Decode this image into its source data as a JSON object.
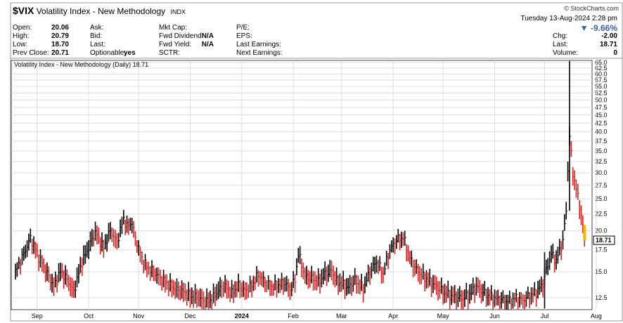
{
  "header": {
    "symbol": "$VIX",
    "name": "Volatility Index - New Methodology",
    "exchange": "INDX",
    "copyright": "© StockCharts.com",
    "datetime": "Tuesday 13-Aug-2024 2:28 pm",
    "change_pct": "▼ -9.66%"
  },
  "quote": {
    "col1": [
      {
        "label": "Open:",
        "value": "20.06"
      },
      {
        "label": "High:",
        "value": "20.79"
      },
      {
        "label": "Low:",
        "value": "18.70"
      },
      {
        "label": "Prev Close:",
        "value": "20.71"
      }
    ],
    "col2": [
      {
        "label": "Ask:",
        "value": ""
      },
      {
        "label": "Bid:",
        "value": ""
      },
      {
        "label": "Last:",
        "value": ""
      },
      {
        "label": "Optionable:",
        "value": "yes"
      }
    ],
    "col3": [
      {
        "label": "Mkt Cap:",
        "value": ""
      },
      {
        "label": "Fwd Dividend:",
        "value": "N/A"
      },
      {
        "label": "Fwd Yield:",
        "value": "N/A"
      },
      {
        "label": "SCTR:",
        "value": ""
      }
    ],
    "col4": [
      {
        "label": "P/E:",
        "value": ""
      },
      {
        "label": "EPS:",
        "value": ""
      },
      {
        "label": "Last Earnings:",
        "value": ""
      },
      {
        "label": "Next Earnings:",
        "value": ""
      }
    ],
    "col5": [
      {
        "label": "Chg:",
        "value": "-2.00"
      },
      {
        "label": "Last:",
        "value": "18.71"
      },
      {
        "label": "Volume:",
        "value": "0"
      }
    ]
  },
  "chart_data": {
    "type": "line",
    "title": "Volatility Index - New Methodology (Daily) 18.71",
    "scale": "log",
    "ylim": [
      11.5,
      66
    ],
    "y_ticks": [
      12.5,
      15.0,
      17.5,
      20.0,
      22.5,
      25.0,
      27.5,
      30.0,
      32.5,
      35.0,
      37.5,
      40.0,
      42.5,
      45.0,
      47.5,
      50.0,
      52.5,
      55.0,
      57.5,
      60.0,
      62.5,
      65.0
    ],
    "y_tick_labels": [
      "12.5",
      "15.0",
      "17.5",
      "20.0",
      "22.5",
      "25.0",
      "27.5",
      "30.0",
      "32.5",
      "35.0",
      "37.5",
      "40.0",
      "42.5",
      "45.0",
      "47.5",
      "50.0",
      "52.5",
      "55.0",
      "57.5",
      "60.0",
      "62.5",
      "65.0"
    ],
    "x_tick_labels": [
      "Sep",
      "Oct",
      "Nov",
      "Dec",
      "2024",
      "Feb",
      "Mar",
      "Apr",
      "May",
      "Jun",
      "Jul",
      "Aug"
    ],
    "x_tick_days": [
      13,
      44,
      74,
      105,
      136,
      167,
      196,
      227,
      257,
      288,
      318,
      349
    ],
    "last_label": "18.71",
    "series": [
      {
        "values": [
          [
            0,
            15.0
          ],
          [
            5,
            17.0
          ],
          [
            9,
            19.0
          ],
          [
            14,
            16.6
          ],
          [
            18,
            15.2
          ],
          [
            23,
            13.5
          ],
          [
            27,
            15.0
          ],
          [
            31,
            14.2
          ],
          [
            35,
            13.0
          ],
          [
            40,
            16.0
          ],
          [
            44,
            17.8
          ],
          [
            48,
            19.8
          ],
          [
            53,
            17.7
          ],
          [
            57,
            20.0
          ],
          [
            61,
            18.4
          ],
          [
            65,
            21.8
          ],
          [
            67,
            20.6
          ],
          [
            70,
            21.2
          ],
          [
            72,
            19.0
          ],
          [
            76,
            16.5
          ],
          [
            79,
            15.5
          ],
          [
            83,
            15.0
          ],
          [
            88,
            14.2
          ],
          [
            93,
            13.6
          ],
          [
            97,
            13.2
          ],
          [
            101,
            13.0
          ],
          [
            105,
            12.6
          ],
          [
            110,
            12.5
          ],
          [
            114,
            12.1
          ],
          [
            118,
            12.3
          ],
          [
            122,
            13.2
          ],
          [
            126,
            13.5
          ],
          [
            130,
            12.9
          ],
          [
            134,
            13.6
          ],
          [
            138,
            13.1
          ],
          [
            142,
            13.6
          ],
          [
            146,
            14.7
          ],
          [
            150,
            14.0
          ],
          [
            154,
            13.5
          ],
          [
            158,
            13.7
          ],
          [
            162,
            13.9
          ],
          [
            165,
            13.2
          ],
          [
            168,
            14.1
          ],
          [
            170,
            17.0
          ],
          [
            174,
            14.5
          ],
          [
            178,
            14.3
          ],
          [
            182,
            13.9
          ],
          [
            186,
            14.7
          ],
          [
            190,
            15.1
          ],
          [
            193,
            14.0
          ],
          [
            196,
            13.8
          ],
          [
            200,
            13.4
          ],
          [
            204,
            14.1
          ],
          [
            209,
            13.3
          ],
          [
            213,
            15.0
          ],
          [
            217,
            16.1
          ],
          [
            221,
            14.8
          ],
          [
            225,
            17.5
          ],
          [
            229,
            18.8
          ],
          [
            233,
            19.1
          ],
          [
            237,
            16.5
          ],
          [
            241,
            15.2
          ],
          [
            245,
            14.5
          ],
          [
            249,
            14.0
          ],
          [
            253,
            13.5
          ],
          [
            257,
            13.0
          ],
          [
            261,
            12.7
          ],
          [
            265,
            12.5
          ],
          [
            269,
            12.4
          ],
          [
            273,
            12.8
          ],
          [
            277,
            13.5
          ],
          [
            281,
            13.0
          ],
          [
            285,
            12.6
          ],
          [
            289,
            12.4
          ],
          [
            293,
            12.3
          ],
          [
            297,
            12.2
          ],
          [
            301,
            12.5
          ],
          [
            305,
            12.3
          ],
          [
            309,
            12.7
          ],
          [
            313,
            13.0
          ],
          [
            317,
            13.8
          ],
          [
            320,
            15.8
          ],
          [
            322,
            17.0
          ],
          [
            325,
            16.2
          ],
          [
            327,
            17.4
          ],
          [
            329,
            18.6
          ],
          [
            331,
            23.0
          ],
          [
            333,
            38.6
          ],
          [
            335,
            30.0
          ],
          [
            337,
            26.8
          ],
          [
            339,
            24.0
          ],
          [
            340,
            22.0
          ],
          [
            341,
            20.7
          ],
          [
            342,
            18.71
          ]
        ]
      }
    ]
  },
  "colors": {
    "up": "#000000",
    "down": "#e02020",
    "grid": "#dcdcdc",
    "last_marker": "#f5b800"
  }
}
